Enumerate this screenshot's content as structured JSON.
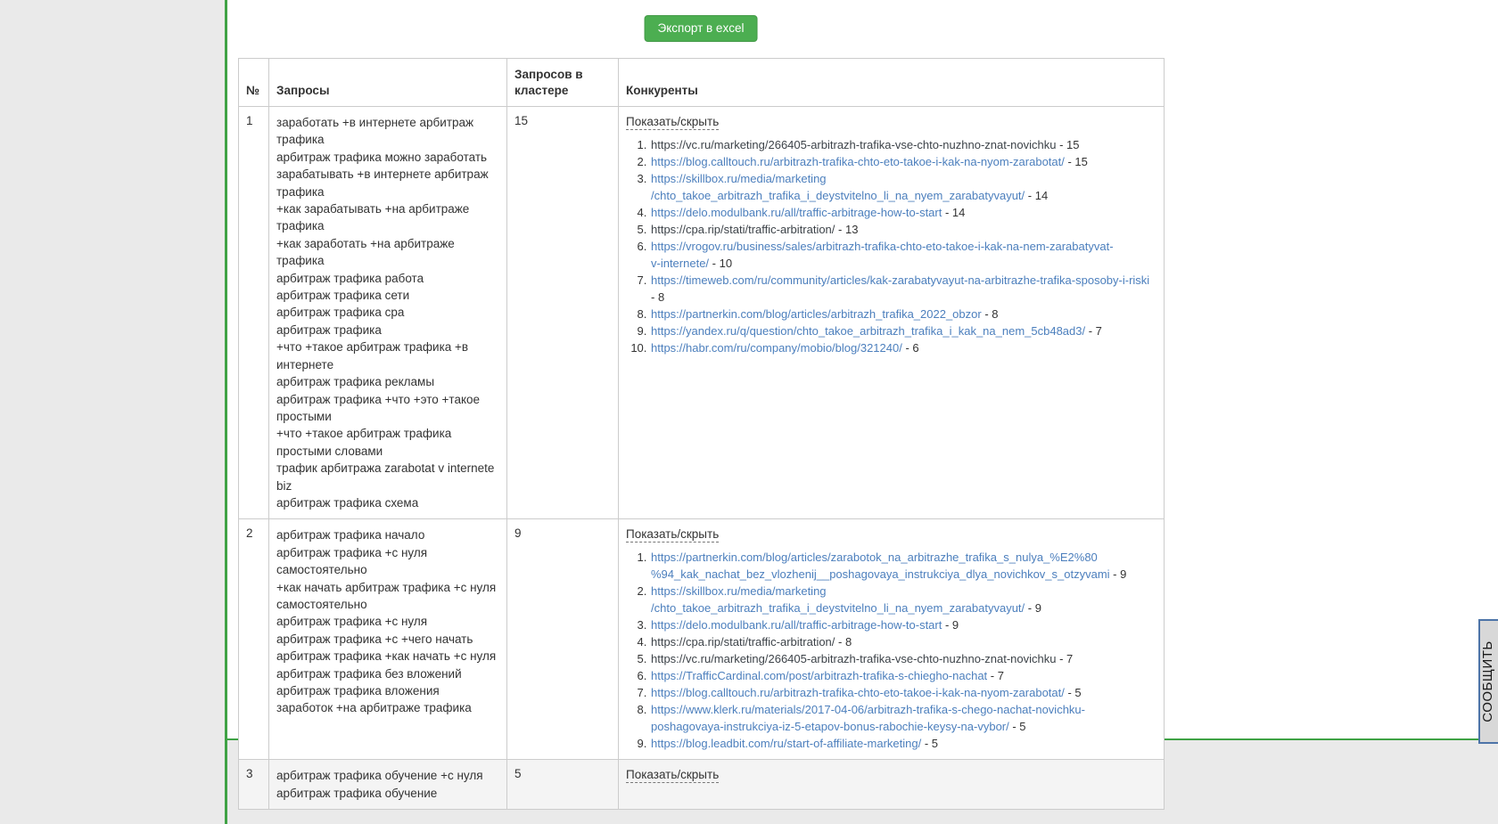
{
  "colors": {
    "accent_green": "#3fa245",
    "button_green": "#4cae51",
    "link_blue": "#4c7fbd",
    "visited_link": "#3d4349",
    "body_gray": "#eaeaea",
    "striped_row": "#f4f4f4"
  },
  "toolbar": {
    "export_button": "Экспорт в excel"
  },
  "feedback_tab": {
    "label": "СООБЩИТЬ"
  },
  "table": {
    "headers": [
      "№",
      "Запросы",
      "Запросов в кластере",
      "Конкуренты"
    ],
    "toggle_label": "Показать/скрыть",
    "rows": [
      {
        "num": "1",
        "cluster_count": "15",
        "queries": [
          "заработать +в интернете арбитраж трафика",
          "арбитраж трафика можно заработать",
          "зарабатывать +в интернете арбитраж трафика",
          "+как зарабатывать +на арбитраже трафика",
          "+как заработать +на арбитраже трафика",
          "арбитраж трафика работа",
          "арбитраж трафика сети",
          "арбитраж трафика cpa",
          "арбитраж трафика",
          "+что +такое арбитраж трафика +в интернете",
          "арбитраж трафика рекламы",
          "арбитраж трафика +что +это +такое простыми",
          "+что +такое арбитраж трафика простыми словами",
          "трафик арбитража zarabotat v internete biz",
          "арбитраж трафика схема"
        ],
        "competitors": [
          {
            "url": "https://vc.ru/marketing/266405-arbitrazh-trafika-vse-chto-nuzhno-znat-novichku",
            "count_text": " - 15",
            "visited": true
          },
          {
            "url": "https://blog.calltouch.ru/arbitrazh-trafika-chto-eto-takoe-i-kak-na-nyom-zarabotat/",
            "count_text": " - 15"
          },
          {
            "url": "https://skillbox.ru/media/marketing\n/chto_takoe_arbitrazh_trafika_i_deystvitelno_li_na_nyem_zarabatyvayut/",
            "count_text": " - 14"
          },
          {
            "url": "https://delo.modulbank.ru/all/traffic-arbitrage-how-to-start",
            "count_text": " - 14"
          },
          {
            "url": "https://cpa.rip/stati/traffic-arbitration/",
            "count_text": " - 13",
            "visited": true
          },
          {
            "url": "https://vrogov.ru/business/sales/arbitrazh-trafika-chto-eto-takoe-i-kak-na-nem-zarabatyvat-\nv-internete/",
            "count_text": " - 10"
          },
          {
            "url": "https://timeweb.com/ru/community/articles/kak-zarabatyvayut-na-arbitrazhe-trafika-sposoby-i-riski",
            "count_text": " - 8"
          },
          {
            "url": "https://partnerkin.com/blog/articles/arbitrazh_trafika_2022_obzor",
            "count_text": " - 8"
          },
          {
            "url": "https://yandex.ru/q/question/chto_takoe_arbitrazh_trafika_i_kak_na_nem_5cb48ad3/",
            "count_text": " - 7"
          },
          {
            "url": "https://habr.com/ru/company/mobio/blog/321240/",
            "count_text": " - 6"
          }
        ]
      },
      {
        "num": "2",
        "cluster_count": "9",
        "queries": [
          "арбитраж трафика начало",
          "арбитраж трафика +с нуля самостоятельно",
          "+как начать арбитраж трафика +с нуля самостоятельно",
          "арбитраж трафика +с нуля",
          "арбитраж трафика +с +чего начать",
          "арбитраж трафика +как начать +с нуля",
          "арбитраж трафика без вложений",
          "арбитраж трафика вложения",
          "заработок +на арбитраже трафика"
        ],
        "competitors": [
          {
            "url": "https://partnerkin.com/blog/articles/zarabotok_na_arbitrazhe_trafika_s_nulya_%E2%80\n%94_kak_nachat_bez_vlozhenij__poshagovaya_instrukciya_dlya_novichkov_s_otzyvami",
            "count_text": " - 9"
          },
          {
            "url": "https://skillbox.ru/media/marketing\n/chto_takoe_arbitrazh_trafika_i_deystvitelno_li_na_nyem_zarabatyvayut/",
            "count_text": " - 9"
          },
          {
            "url": "https://delo.modulbank.ru/all/traffic-arbitrage-how-to-start",
            "count_text": " - 9"
          },
          {
            "url": "https://cpa.rip/stati/traffic-arbitration/",
            "count_text": " - 8",
            "visited": true
          },
          {
            "url": "https://vc.ru/marketing/266405-arbitrazh-trafika-vse-chto-nuzhno-znat-novichku",
            "count_text": " - 7",
            "visited": true
          },
          {
            "url": "https://TrafficCardinal.com/post/arbitrazh-trafika-s-chiegho-nachat",
            "count_text": " - 7"
          },
          {
            "url": "https://blog.calltouch.ru/arbitrazh-trafika-chto-eto-takoe-i-kak-na-nyom-zarabotat/",
            "count_text": " - 5"
          },
          {
            "url": "https://www.klerk.ru/materials/2017-04-06/arbitrazh-trafika-s-chego-nachat-novichku-\nposhagovaya-instrukciya-iz-5-etapov-bonus-rabochie-keysy-na-vybor/",
            "count_text": " - 5"
          },
          {
            "url": "https://blog.leadbit.com/ru/start-of-affiliate-marketing/",
            "count_text": " - 5"
          }
        ]
      },
      {
        "num": "3",
        "cluster_count": "5",
        "queries": [
          "арбитраж трафика обучение +с нуля",
          "арбитраж трафика обучение"
        ],
        "competitors": []
      }
    ]
  }
}
